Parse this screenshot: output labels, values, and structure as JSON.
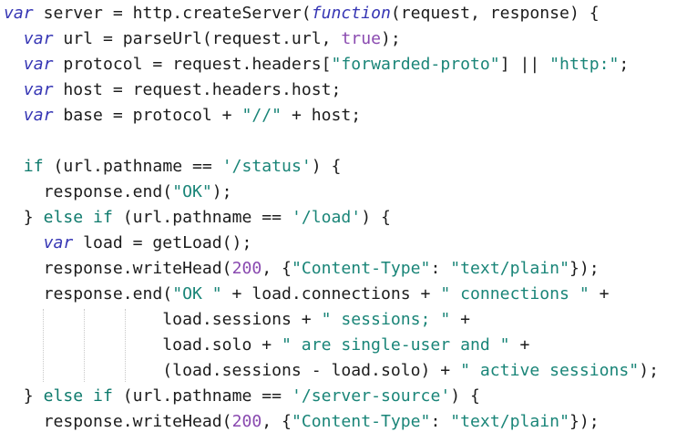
{
  "colors": {
    "plain": "#1c1c1c",
    "keyword": "#3636b4",
    "control": "#0e7a6c",
    "string": "#1a8578",
    "number": "#8a4ab0",
    "background": "#ffffff",
    "indent_guide": "#c8c8c8"
  },
  "code": {
    "lines": [
      {
        "tokens": [
          {
            "t": "var",
            "c": "keyword",
            "i": true
          },
          {
            "t": " server = http.createServer(",
            "c": "plain"
          },
          {
            "t": "function",
            "c": "keyword",
            "i": true
          },
          {
            "t": "(request, response) {",
            "c": "plain"
          }
        ]
      },
      {
        "tokens": [
          {
            "t": "  ",
            "c": "plain"
          },
          {
            "t": "var",
            "c": "keyword",
            "i": true
          },
          {
            "t": " url = parseUrl(request.url, ",
            "c": "plain"
          },
          {
            "t": "true",
            "c": "number"
          },
          {
            "t": ");",
            "c": "plain"
          }
        ]
      },
      {
        "tokens": [
          {
            "t": "  ",
            "c": "plain"
          },
          {
            "t": "var",
            "c": "keyword",
            "i": true
          },
          {
            "t": " protocol = request.headers[",
            "c": "plain"
          },
          {
            "t": "\"forwarded-proto\"",
            "c": "string"
          },
          {
            "t": "] || ",
            "c": "plain"
          },
          {
            "t": "\"http:\"",
            "c": "string"
          },
          {
            "t": ";",
            "c": "plain"
          }
        ]
      },
      {
        "tokens": [
          {
            "t": "  ",
            "c": "plain"
          },
          {
            "t": "var",
            "c": "keyword",
            "i": true
          },
          {
            "t": " host = request.headers.host;",
            "c": "plain"
          }
        ]
      },
      {
        "tokens": [
          {
            "t": "  ",
            "c": "plain"
          },
          {
            "t": "var",
            "c": "keyword",
            "i": true
          },
          {
            "t": " base = protocol + ",
            "c": "plain"
          },
          {
            "t": "\"//\"",
            "c": "string"
          },
          {
            "t": " + host;",
            "c": "plain"
          }
        ]
      },
      {
        "tokens": []
      },
      {
        "tokens": [
          {
            "t": "  ",
            "c": "plain"
          },
          {
            "t": "if",
            "c": "control"
          },
          {
            "t": " (url.pathname == ",
            "c": "plain"
          },
          {
            "t": "'/status'",
            "c": "string"
          },
          {
            "t": ") {",
            "c": "plain"
          }
        ]
      },
      {
        "tokens": [
          {
            "t": "    response.end(",
            "c": "plain"
          },
          {
            "t": "\"OK\"",
            "c": "string"
          },
          {
            "t": ");",
            "c": "plain"
          }
        ]
      },
      {
        "tokens": [
          {
            "t": "  } ",
            "c": "plain"
          },
          {
            "t": "else if",
            "c": "control"
          },
          {
            "t": " (url.pathname == ",
            "c": "plain"
          },
          {
            "t": "'/load'",
            "c": "string"
          },
          {
            "t": ") {",
            "c": "plain"
          }
        ]
      },
      {
        "tokens": [
          {
            "t": "    ",
            "c": "plain"
          },
          {
            "t": "var",
            "c": "keyword",
            "i": true
          },
          {
            "t": " load = getLoad();",
            "c": "plain"
          }
        ]
      },
      {
        "tokens": [
          {
            "t": "    response.writeHead(",
            "c": "plain"
          },
          {
            "t": "200",
            "c": "number"
          },
          {
            "t": ", {",
            "c": "plain"
          },
          {
            "t": "\"Content-Type\"",
            "c": "string"
          },
          {
            "t": ": ",
            "c": "plain"
          },
          {
            "t": "\"text/plain\"",
            "c": "string"
          },
          {
            "t": "});",
            "c": "plain"
          }
        ]
      },
      {
        "tokens": [
          {
            "t": "    response.end(",
            "c": "plain"
          },
          {
            "t": "\"OK \"",
            "c": "string"
          },
          {
            "t": " + load.connections + ",
            "c": "plain"
          },
          {
            "t": "\" connections \"",
            "c": "string"
          },
          {
            "t": " +",
            "c": "plain"
          }
        ]
      },
      {
        "tokens": [
          {
            "t": "                load.sessions + ",
            "c": "plain"
          },
          {
            "t": "\" sessions; \"",
            "c": "string"
          },
          {
            "t": " +",
            "c": "plain"
          }
        ]
      },
      {
        "tokens": [
          {
            "t": "                load.solo + ",
            "c": "plain"
          },
          {
            "t": "\" are single-user and \"",
            "c": "string"
          },
          {
            "t": " +",
            "c": "plain"
          }
        ]
      },
      {
        "tokens": [
          {
            "t": "                (load.sessions - load.solo) + ",
            "c": "plain"
          },
          {
            "t": "\" active sessions\"",
            "c": "string"
          },
          {
            "t": ");",
            "c": "plain"
          }
        ]
      },
      {
        "tokens": [
          {
            "t": "  } ",
            "c": "plain"
          },
          {
            "t": "else if",
            "c": "control"
          },
          {
            "t": " (url.pathname == ",
            "c": "plain"
          },
          {
            "t": "'/server-source'",
            "c": "string"
          },
          {
            "t": ") {",
            "c": "plain"
          }
        ]
      },
      {
        "tokens": [
          {
            "t": "    response.writeHead(",
            "c": "plain"
          },
          {
            "t": "200",
            "c": "number"
          },
          {
            "t": ", {",
            "c": "plain"
          },
          {
            "t": "\"Content-Type\"",
            "c": "string"
          },
          {
            "t": ": ",
            "c": "plain"
          },
          {
            "t": "\"text/plain\"",
            "c": "string"
          },
          {
            "t": "});",
            "c": "plain"
          }
        ]
      }
    ]
  }
}
